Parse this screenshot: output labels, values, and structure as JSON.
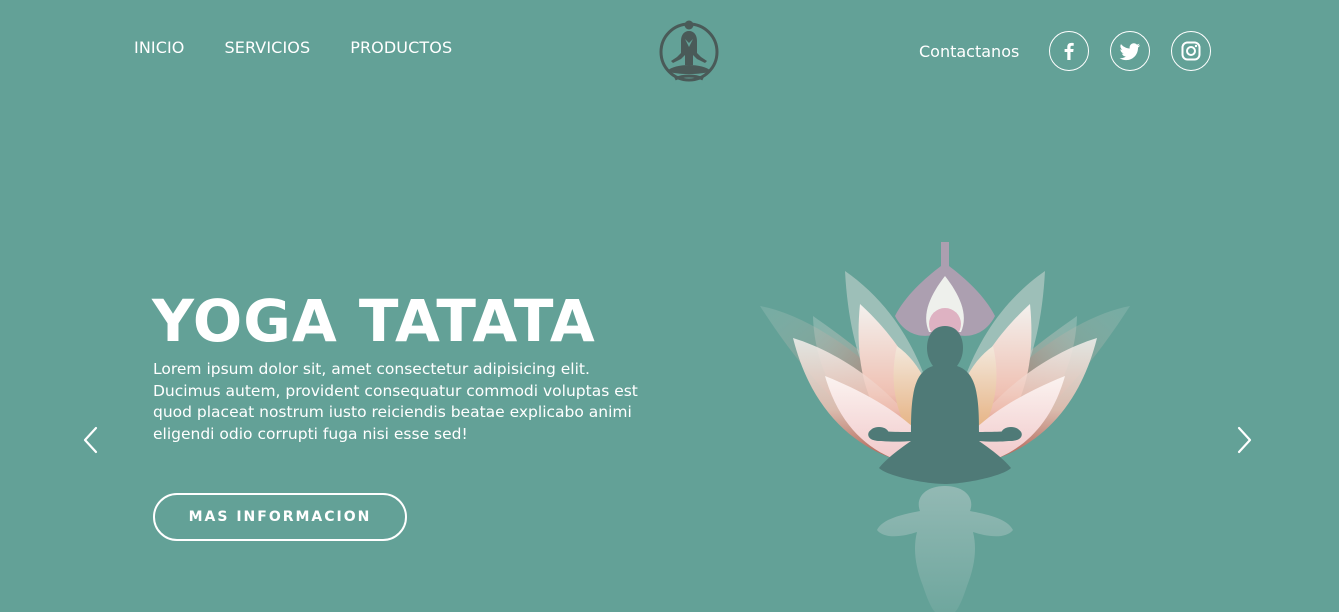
{
  "nav": {
    "links": [
      "INICIO",
      "SERVICIOS",
      "PRODUCTOS"
    ],
    "contact": "Contactanos"
  },
  "social": {
    "icons": [
      "facebook-icon",
      "twitter-icon",
      "instagram-icon"
    ]
  },
  "hero": {
    "title": "YOGA TATATA",
    "description_lines": [
      "Lorem ipsum dolor sit, amet consectetur adipisicing elit.",
      "Ducimus autem, provident consequatur commodi voluptas est",
      "quod placeat nostrum iusto reiciendis beatae explicabo animi",
      "eligendi odio corrupti fuga nisi esse sed!"
    ],
    "cta_label": "MAS INFORMACION"
  },
  "colors": {
    "background": "#63a197",
    "text": "#ffffff",
    "silhouette": "#4f7a77",
    "logo": "#4a5a58"
  }
}
